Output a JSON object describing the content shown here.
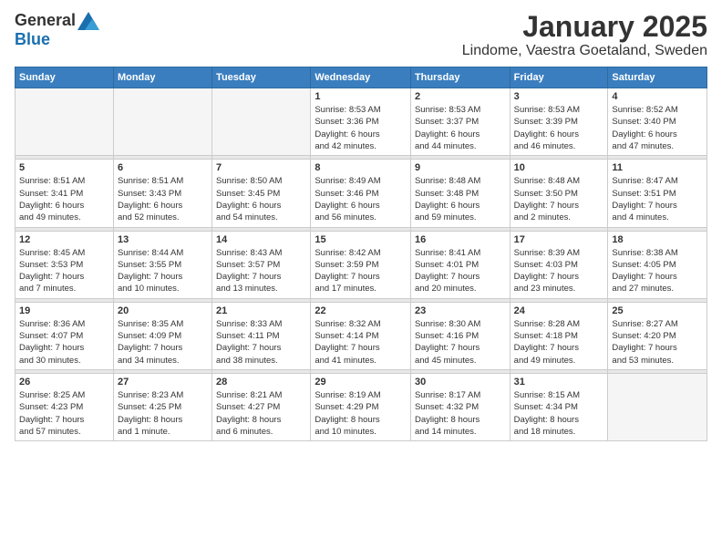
{
  "header": {
    "logo_general": "General",
    "logo_blue": "Blue",
    "month_title": "January 2025",
    "location": "Lindome, Vaestra Goetaland, Sweden"
  },
  "days_of_week": [
    "Sunday",
    "Monday",
    "Tuesday",
    "Wednesday",
    "Thursday",
    "Friday",
    "Saturday"
  ],
  "weeks": [
    [
      {
        "day": "",
        "info": ""
      },
      {
        "day": "",
        "info": ""
      },
      {
        "day": "",
        "info": ""
      },
      {
        "day": "1",
        "info": "Sunrise: 8:53 AM\nSunset: 3:36 PM\nDaylight: 6 hours\nand 42 minutes."
      },
      {
        "day": "2",
        "info": "Sunrise: 8:53 AM\nSunset: 3:37 PM\nDaylight: 6 hours\nand 44 minutes."
      },
      {
        "day": "3",
        "info": "Sunrise: 8:53 AM\nSunset: 3:39 PM\nDaylight: 6 hours\nand 46 minutes."
      },
      {
        "day": "4",
        "info": "Sunrise: 8:52 AM\nSunset: 3:40 PM\nDaylight: 6 hours\nand 47 minutes."
      }
    ],
    [
      {
        "day": "5",
        "info": "Sunrise: 8:51 AM\nSunset: 3:41 PM\nDaylight: 6 hours\nand 49 minutes."
      },
      {
        "day": "6",
        "info": "Sunrise: 8:51 AM\nSunset: 3:43 PM\nDaylight: 6 hours\nand 52 minutes."
      },
      {
        "day": "7",
        "info": "Sunrise: 8:50 AM\nSunset: 3:45 PM\nDaylight: 6 hours\nand 54 minutes."
      },
      {
        "day": "8",
        "info": "Sunrise: 8:49 AM\nSunset: 3:46 PM\nDaylight: 6 hours\nand 56 minutes."
      },
      {
        "day": "9",
        "info": "Sunrise: 8:48 AM\nSunset: 3:48 PM\nDaylight: 6 hours\nand 59 minutes."
      },
      {
        "day": "10",
        "info": "Sunrise: 8:48 AM\nSunset: 3:50 PM\nDaylight: 7 hours\nand 2 minutes."
      },
      {
        "day": "11",
        "info": "Sunrise: 8:47 AM\nSunset: 3:51 PM\nDaylight: 7 hours\nand 4 minutes."
      }
    ],
    [
      {
        "day": "12",
        "info": "Sunrise: 8:45 AM\nSunset: 3:53 PM\nDaylight: 7 hours\nand 7 minutes."
      },
      {
        "day": "13",
        "info": "Sunrise: 8:44 AM\nSunset: 3:55 PM\nDaylight: 7 hours\nand 10 minutes."
      },
      {
        "day": "14",
        "info": "Sunrise: 8:43 AM\nSunset: 3:57 PM\nDaylight: 7 hours\nand 13 minutes."
      },
      {
        "day": "15",
        "info": "Sunrise: 8:42 AM\nSunset: 3:59 PM\nDaylight: 7 hours\nand 17 minutes."
      },
      {
        "day": "16",
        "info": "Sunrise: 8:41 AM\nSunset: 4:01 PM\nDaylight: 7 hours\nand 20 minutes."
      },
      {
        "day": "17",
        "info": "Sunrise: 8:39 AM\nSunset: 4:03 PM\nDaylight: 7 hours\nand 23 minutes."
      },
      {
        "day": "18",
        "info": "Sunrise: 8:38 AM\nSunset: 4:05 PM\nDaylight: 7 hours\nand 27 minutes."
      }
    ],
    [
      {
        "day": "19",
        "info": "Sunrise: 8:36 AM\nSunset: 4:07 PM\nDaylight: 7 hours\nand 30 minutes."
      },
      {
        "day": "20",
        "info": "Sunrise: 8:35 AM\nSunset: 4:09 PM\nDaylight: 7 hours\nand 34 minutes."
      },
      {
        "day": "21",
        "info": "Sunrise: 8:33 AM\nSunset: 4:11 PM\nDaylight: 7 hours\nand 38 minutes."
      },
      {
        "day": "22",
        "info": "Sunrise: 8:32 AM\nSunset: 4:14 PM\nDaylight: 7 hours\nand 41 minutes."
      },
      {
        "day": "23",
        "info": "Sunrise: 8:30 AM\nSunset: 4:16 PM\nDaylight: 7 hours\nand 45 minutes."
      },
      {
        "day": "24",
        "info": "Sunrise: 8:28 AM\nSunset: 4:18 PM\nDaylight: 7 hours\nand 49 minutes."
      },
      {
        "day": "25",
        "info": "Sunrise: 8:27 AM\nSunset: 4:20 PM\nDaylight: 7 hours\nand 53 minutes."
      }
    ],
    [
      {
        "day": "26",
        "info": "Sunrise: 8:25 AM\nSunset: 4:23 PM\nDaylight: 7 hours\nand 57 minutes."
      },
      {
        "day": "27",
        "info": "Sunrise: 8:23 AM\nSunset: 4:25 PM\nDaylight: 8 hours\nand 1 minute."
      },
      {
        "day": "28",
        "info": "Sunrise: 8:21 AM\nSunset: 4:27 PM\nDaylight: 8 hours\nand 6 minutes."
      },
      {
        "day": "29",
        "info": "Sunrise: 8:19 AM\nSunset: 4:29 PM\nDaylight: 8 hours\nand 10 minutes."
      },
      {
        "day": "30",
        "info": "Sunrise: 8:17 AM\nSunset: 4:32 PM\nDaylight: 8 hours\nand 14 minutes."
      },
      {
        "day": "31",
        "info": "Sunrise: 8:15 AM\nSunset: 4:34 PM\nDaylight: 8 hours\nand 18 minutes."
      },
      {
        "day": "",
        "info": ""
      }
    ]
  ]
}
